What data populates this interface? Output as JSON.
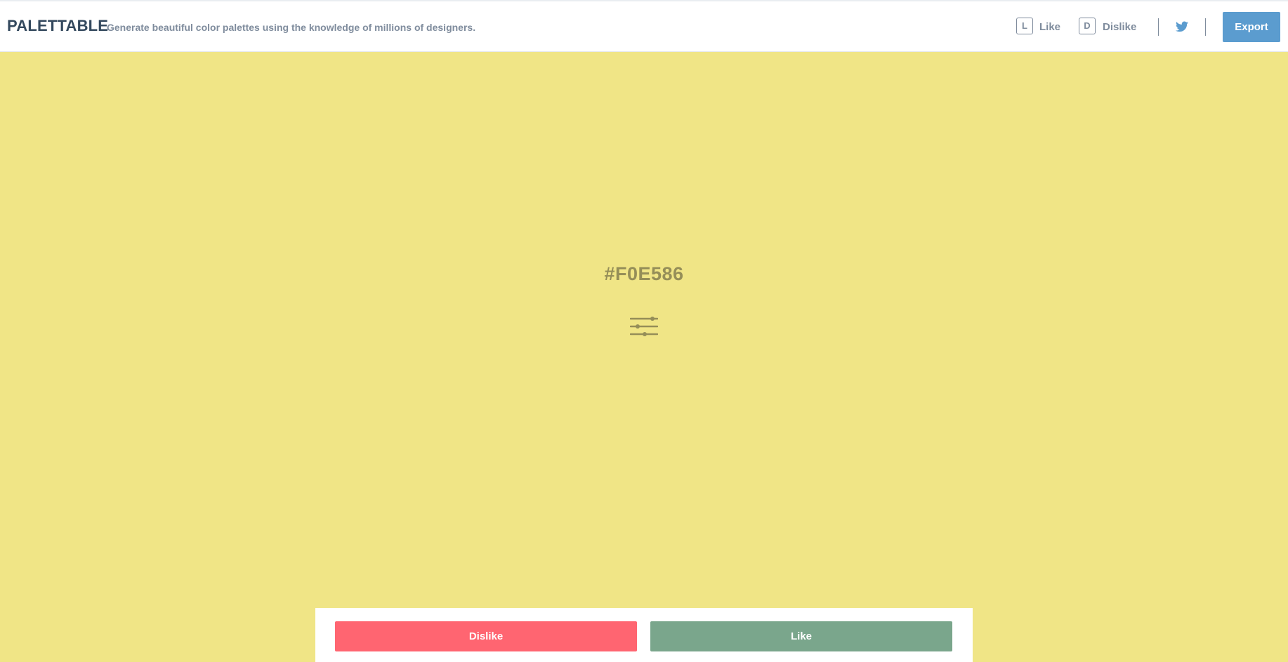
{
  "header": {
    "brand": "PALETTABLE",
    "tagline": "Generate beautiful color palettes using the knowledge of millions of designers.",
    "shortcuts": [
      {
        "key": "L",
        "label": "Like"
      },
      {
        "key": "D",
        "label": "Dislike"
      }
    ],
    "twitter_icon": "twitter-icon",
    "export_label": "Export"
  },
  "palette": {
    "current_hex": "#F0E586",
    "adjust_icon": "sliders-icon"
  },
  "actions": {
    "dislike_label": "Dislike",
    "like_label": "Like"
  },
  "colors": {
    "swatch": "#F0E586",
    "export_button": "#5b9ccf",
    "dislike_button": "#ff6571",
    "like_button": "#7aa68c",
    "brand_text": "#34495e",
    "muted_text": "#7f8c9d"
  }
}
